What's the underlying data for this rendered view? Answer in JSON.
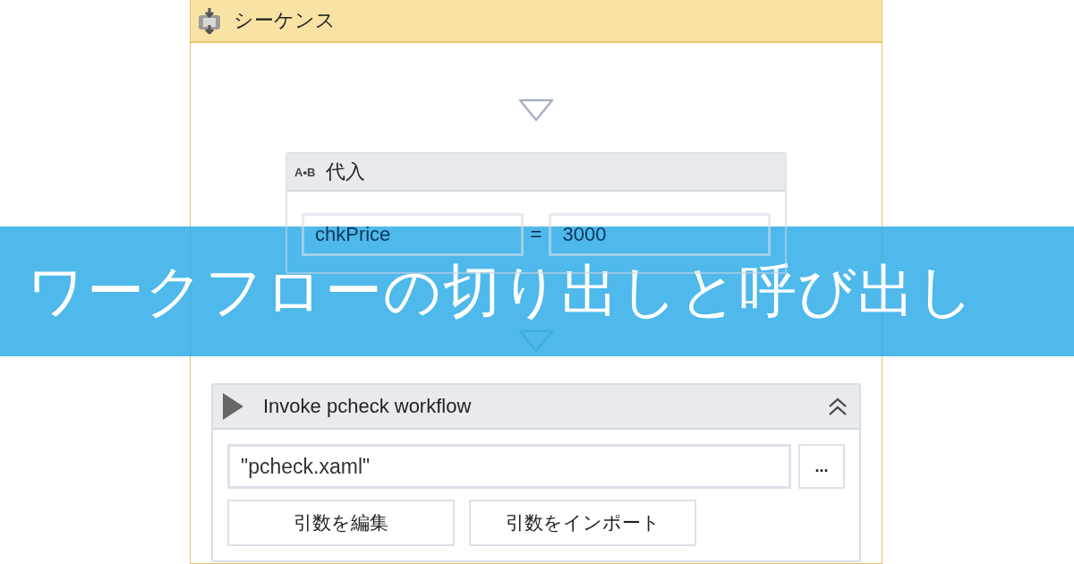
{
  "sequence": {
    "title": "シーケンス"
  },
  "activities": [
    {
      "kind": "assign",
      "icon_text": "A•B",
      "title": "代入",
      "to": "chkPrice",
      "operator": "=",
      "value": "3000"
    },
    {
      "kind": "invoke",
      "title": "Invoke pcheck workflow",
      "expanded": true,
      "file": "\"pcheck.xaml\"",
      "browse": "...",
      "buttons": [
        "引数を編集",
        "引数をインポート"
      ]
    }
  ],
  "banner": {
    "title": "ワークフローの切り出しと呼び出し"
  }
}
